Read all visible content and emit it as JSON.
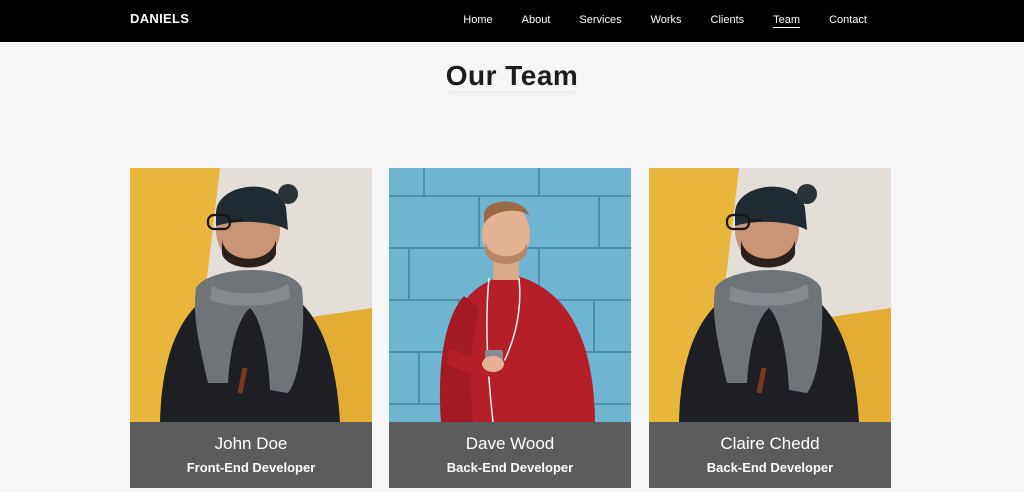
{
  "nav": {
    "logo": "DANIELS",
    "links": [
      "Home",
      "About",
      "Services",
      "Works",
      "Clients",
      "Team",
      "Contact"
    ],
    "active": "Team"
  },
  "section": {
    "title": "Our Team"
  },
  "team": [
    {
      "name": "John Doe",
      "role": "Front-End Developer",
      "photo": "man-with-beanie-and-scarf"
    },
    {
      "name": "Dave Wood",
      "role": "Back-End Developer",
      "photo": "man-in-red-sweater-with-phone"
    },
    {
      "name": "Claire Chedd",
      "role": "Back-End Developer",
      "photo": "man-with-beanie-and-scarf"
    }
  ],
  "colors": {
    "navbar": "#000000",
    "page_bg": "#f6f6f6",
    "card_info_bg": "#5c5c5c",
    "title": "#1c1c1c"
  }
}
